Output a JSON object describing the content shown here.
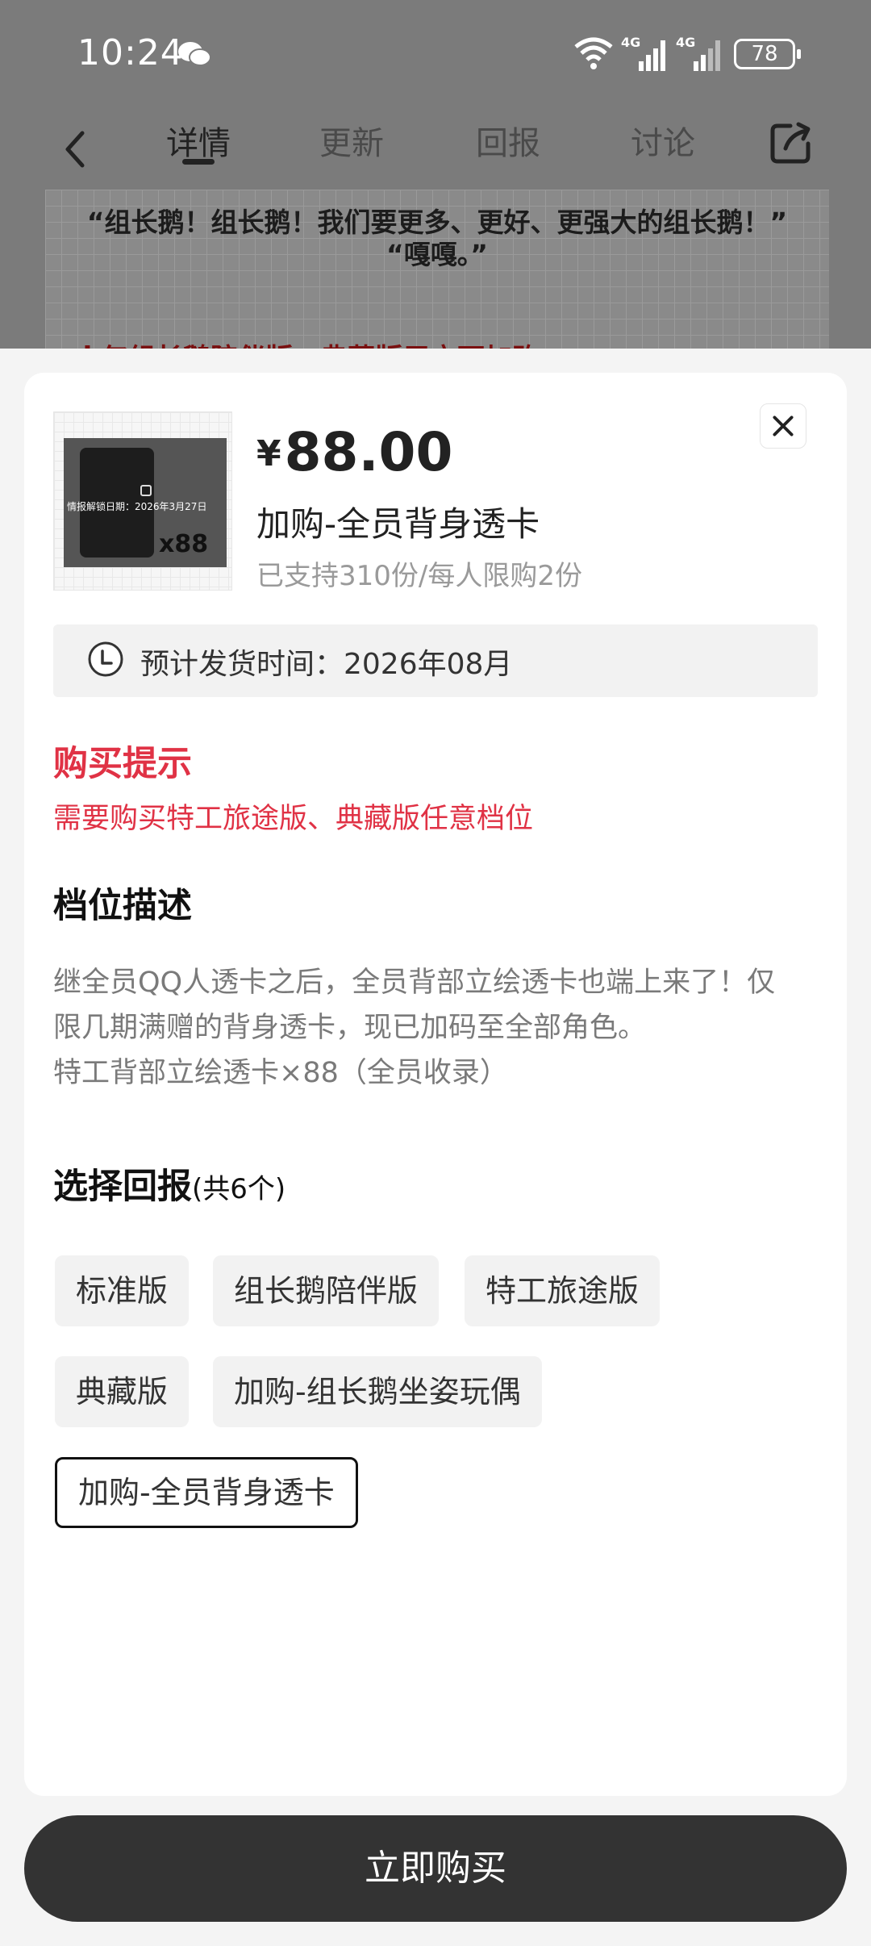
{
  "status_bar": {
    "time": "10:24",
    "signal_labels": [
      "4G",
      "4G"
    ],
    "battery": "78"
  },
  "nav": {
    "tabs": [
      "详情",
      "更新",
      "回报",
      "讨论"
    ],
    "active_tab": "详情"
  },
  "banner": {
    "line1": "“组长鹅！组长鹅！我们要更多、更好、更强大的组长鹅！”",
    "line2": "“嘎嘎。”",
    "red_text": "※仅组长鹅陪伴版、典藏版用户可加购"
  },
  "product": {
    "thumbnail_text": "情报解锁日期：2026年3月27日",
    "thumbnail_count": "x88",
    "currency": "¥",
    "price": "88.00",
    "title": "加购-全员背身透卡",
    "support_text": "已支持310份/每人限购2份",
    "ship_time": "预计发货时间：2026年08月"
  },
  "purchase_tip": {
    "heading": "购买提示",
    "text": "需要购买特工旅途版、典藏版任意档位"
  },
  "description": {
    "heading": "档位描述",
    "lines": [
      "继全员QQ人透卡之后，全员背部立绘透卡也端上来了！仅",
      "限几期满赠的背身透卡，现已加码至全部角色。",
      "特工背部立绘透卡×88（全员收录）"
    ]
  },
  "choose": {
    "heading": "选择回报",
    "count": "(共6个)",
    "options": [
      "标准版",
      "组长鹅陪伴版",
      "特工旅途版",
      "典藏版",
      "加购-组长鹅坐姿玩偶",
      "加购-全员背身透卡"
    ],
    "selected": "加购-全员背身透卡"
  },
  "buy_button": "立即购买",
  "colors": {
    "accent_red": "#e03245",
    "button_dark": "#333333"
  }
}
